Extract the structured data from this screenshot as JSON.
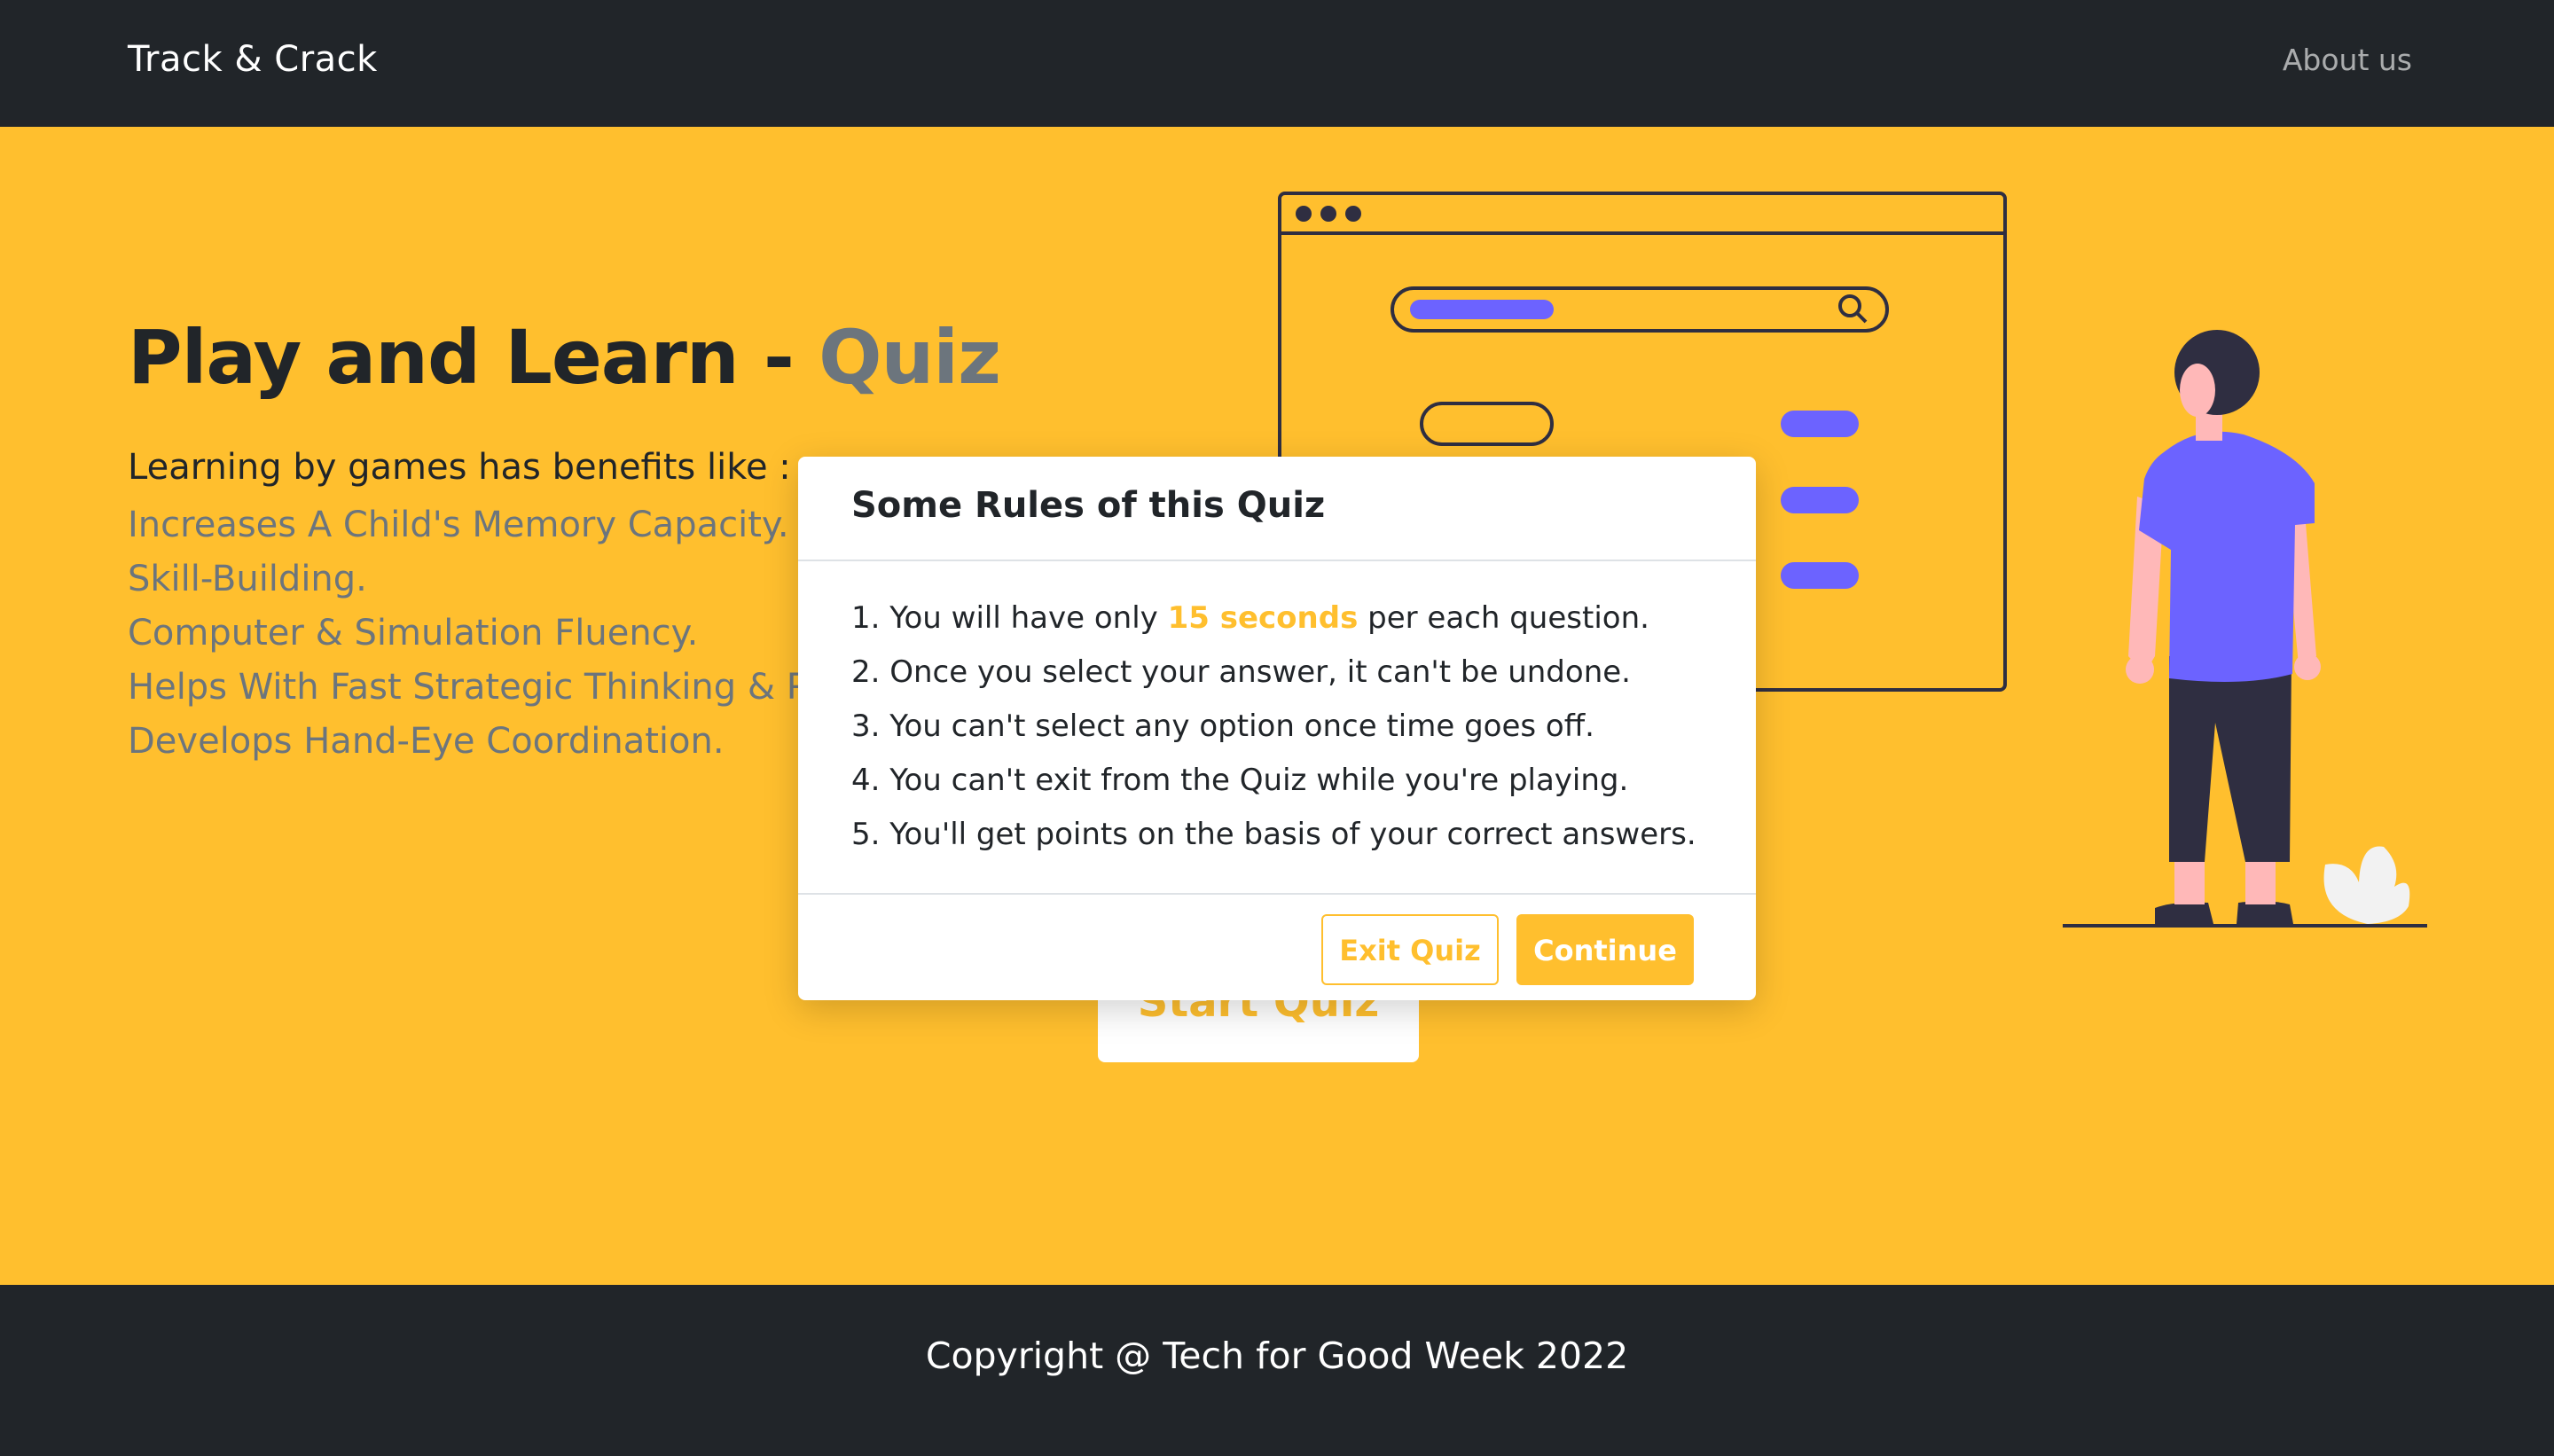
{
  "navbar": {
    "brand": "Track & Crack",
    "about_link": "About us"
  },
  "hero": {
    "title_main": "Play and Learn - ",
    "title_accent": "Quiz",
    "lead": "Learning by games has benefits like :",
    "benefits": [
      "Increases A Child's Memory Capacity.",
      "Skill-Building.",
      "Computer & Simulation Fluency.",
      "Helps With Fast Strategic Thinking & Problem-Solving.",
      "Develops Hand-Eye Coordination."
    ],
    "start_button": "Start Quiz"
  },
  "modal": {
    "title": "Some Rules of this Quiz",
    "rules": [
      {
        "before": "1. You will have only ",
        "highlight": "15 seconds",
        "after": " per each question."
      },
      {
        "before": "2. Once you select your answer, it can't be undone.",
        "highlight": "",
        "after": ""
      },
      {
        "before": "3. You can't select any option once time goes off.",
        "highlight": "",
        "after": ""
      },
      {
        "before": "4. You can't exit from the Quiz while you're playing.",
        "highlight": "",
        "after": ""
      },
      {
        "before": "5. You'll get points on the basis of your correct answers.",
        "highlight": "",
        "after": ""
      }
    ],
    "exit_button": "Exit Quiz",
    "continue_button": "Continue"
  },
  "footer": {
    "copyright": "Copyright @ Tech for Good Week 2022"
  },
  "colors": {
    "accent": "#ffbf2e",
    "dark": "#212529",
    "muted": "#6c757d",
    "illustration_purple": "#6c63ff"
  },
  "icons": [
    "search-icon",
    "browser-window-illustration",
    "person-illustration",
    "plant-illustration"
  ]
}
